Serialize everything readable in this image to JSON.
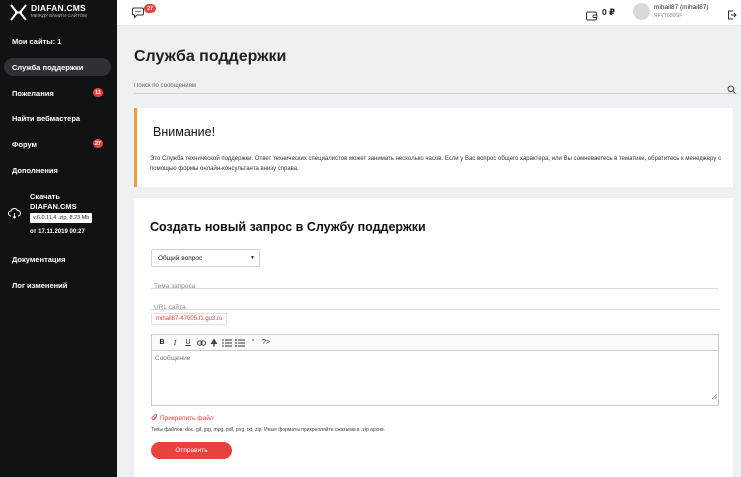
{
  "brand": {
    "title": "DIAFAN.CMS",
    "subtitle": "МЕЖДУ ВАМИ И САЙТОМ"
  },
  "sidebar": {
    "items": [
      {
        "label": "Мои сайты: 1",
        "badge": ""
      },
      {
        "label": "Служба поддержки",
        "badge": ""
      },
      {
        "label": "Пожелания",
        "badge": "11"
      },
      {
        "label": "Найти вебмастера",
        "badge": ""
      },
      {
        "label": "Форум",
        "badge": "27"
      },
      {
        "label": "Дополнения",
        "badge": ""
      }
    ],
    "download": {
      "title": "Скачать DIAFAN.CMS",
      "version": "v.6.0.11.4 .zip, 8.23 Mb",
      "date": "от 17.11.2019 00:27"
    },
    "bottom_items": [
      {
        "label": "Документация"
      },
      {
        "label": "Лог изменений"
      }
    ]
  },
  "topbar": {
    "messages_count": "27",
    "balance": "0 ₽",
    "user_name": "mihail87 (mihail87)",
    "user_id": "RFVT680GF"
  },
  "main": {
    "page_title": "Служба поддержки",
    "search_placeholder": "Поиск по сообщениям",
    "alert": {
      "title": "Внимание!",
      "text": "Это Служба технической поддержки. Ответ технических специалистов может занимать несколько часов. Если у Вас вопрос общего характера, или Вы сомневаетесь в тематике, обратитесь к менеджеру с помощью формы онлайн-консультанта внизу справа."
    },
    "form": {
      "title": "Создать новый запрос в Службу поддержки",
      "category_selected": "Общий вопрос",
      "subject_placeholder": "Тема запроса",
      "url_placeholder": "URL сайта",
      "site_tag": "mihail87-47605.f1.gu3.ru",
      "toolbar": {
        "bold": "B",
        "italic": "I",
        "underline": "U",
        "quote": "“",
        "code": "?>"
      },
      "message_placeholder": "Сообщение",
      "attach_label": "Прикрепить файл",
      "file_types": "Типы файлов: doc, gif, jpg, mpg, pdf, png, txt, zip. Иные форматы прикрепляйте сжатыми в .zip архив.",
      "submit_label": "Отправить"
    }
  },
  "colors": {
    "accent": "#e8423f",
    "sidebar_bg": "#111214",
    "alert_border": "#f19d3c"
  }
}
